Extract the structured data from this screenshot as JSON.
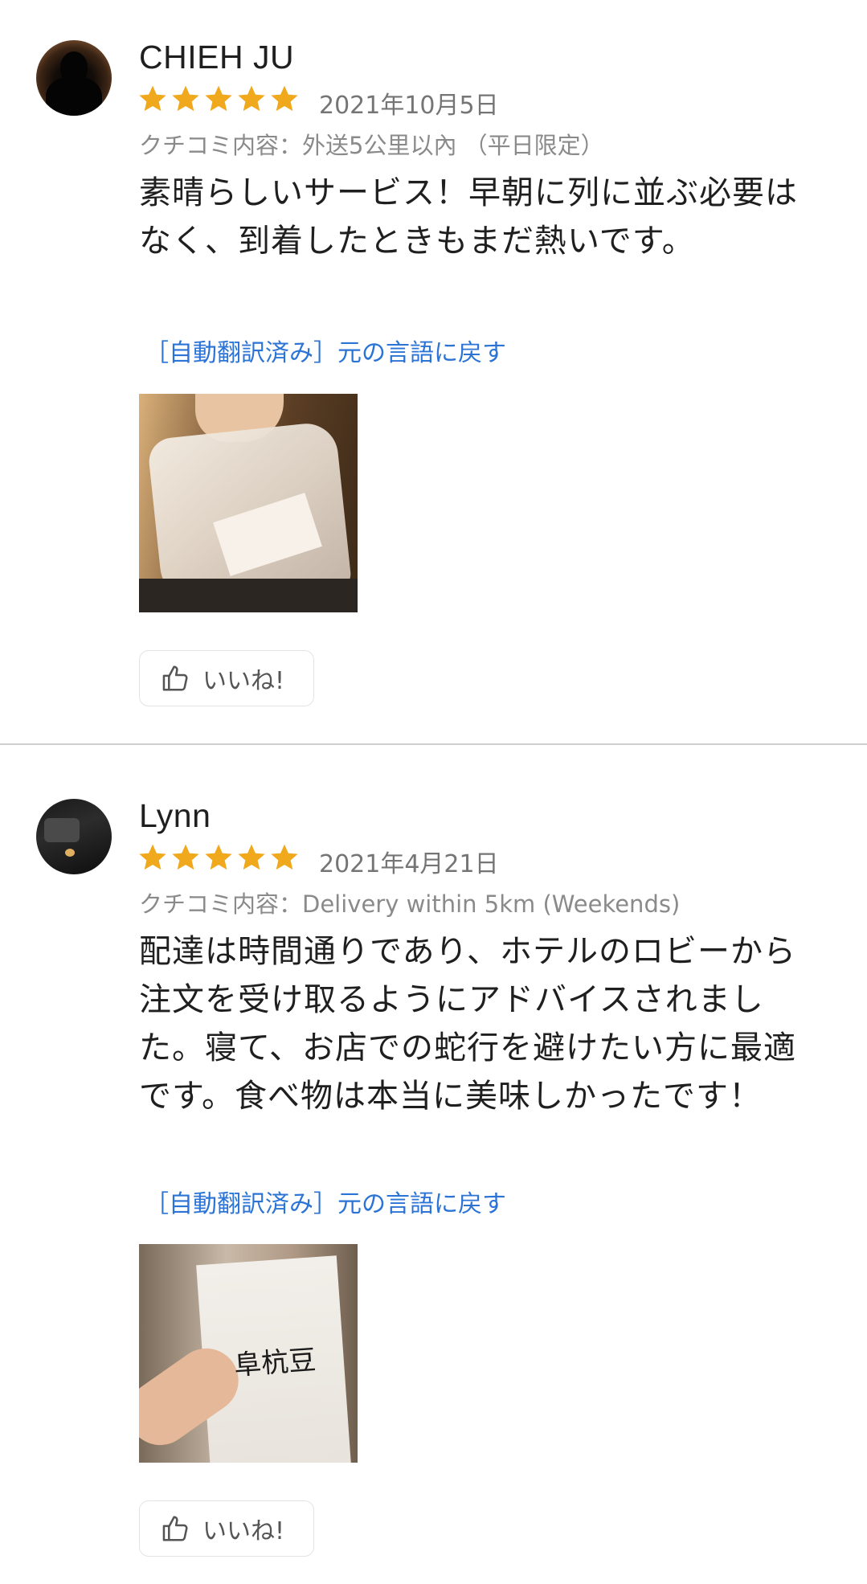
{
  "colors": {
    "star": "#f0a81c",
    "link": "#2b74d6",
    "date": "#757575",
    "subtitle": "#8a8a8a"
  },
  "reviews": [
    {
      "author": "CHIEH JU",
      "rating": 5,
      "date": "2021年10月5日",
      "subtitle": "クチコミ内容：外送5公里以內 （平日限定）",
      "text": "素晴らしいサービス！早朝に列に並ぶ必要はなく、到着したときもまだ熱いです。",
      "translate_link": "［自動翻訳済み］元の言語に戻す",
      "like_label": "いいね!",
      "icons": {
        "avatar": "user-avatar",
        "like": "thumbs-up-icon"
      }
    },
    {
      "author": "Lynn",
      "rating": 5,
      "date": "2021年4月21日",
      "subtitle": "クチコミ内容：Delivery within 5km (Weekends)",
      "text": "配達は時間通りであり、ホテルのロビーから注文を受け取るようにアドバイスされました。寝て、お店での蛇行を避けたい方に最適です。食べ物は本当に美味しかったです！",
      "translate_link": "［自動翻訳済み］元の言語に戻す",
      "like_label": "いいね!",
      "photo_logo_text": "阜杭豆",
      "icons": {
        "avatar": "user-avatar",
        "like": "thumbs-up-icon"
      }
    }
  ]
}
